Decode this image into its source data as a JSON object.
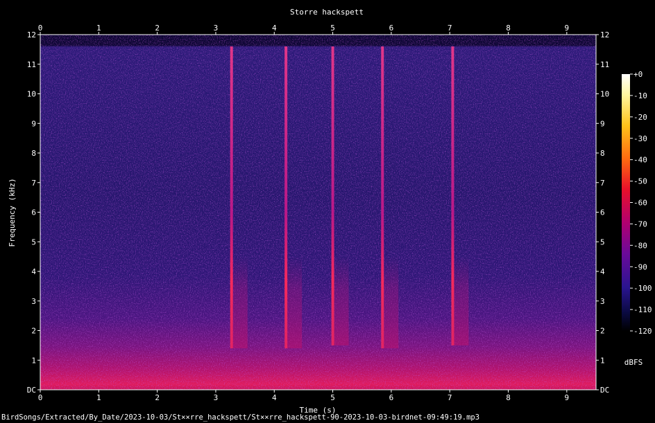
{
  "chart_data": {
    "type": "heatmap",
    "title": "Storre hackspett",
    "xlabel": "Time (s)",
    "ylabel": "Frequency (kHz)",
    "xlim": [
      0,
      9.5
    ],
    "ylim": [
      0,
      12
    ],
    "x_ticks": [
      "0",
      "1",
      "2",
      "3",
      "4",
      "5",
      "6",
      "7",
      "8",
      "9"
    ],
    "y_ticks": [
      "DC",
      "1",
      "2",
      "3",
      "4",
      "5",
      "6",
      "7",
      "8",
      "9",
      "10",
      "11",
      "12"
    ],
    "colorbar": {
      "label": "dBFS",
      "ticks": [
        "+0",
        "-10",
        "-20",
        "-30",
        "-40",
        "-50",
        "-60",
        "-70",
        "-80",
        "-90",
        "-100",
        "-110",
        "-120"
      ],
      "range": [
        -120,
        0
      ]
    },
    "signal_top_khz": 11.6,
    "drum_strikes": [
      {
        "time_s": 3.27,
        "low_khz": 1.4,
        "high_khz": 11.6
      },
      {
        "time_s": 4.2,
        "low_khz": 1.4,
        "high_khz": 11.6
      },
      {
        "time_s": 5.0,
        "low_khz": 1.5,
        "high_khz": 11.6
      },
      {
        "time_s": 5.85,
        "low_khz": 1.4,
        "high_khz": 11.6
      },
      {
        "time_s": 7.05,
        "low_khz": 1.5,
        "high_khz": 11.6
      }
    ]
  },
  "footer": {
    "file_path": "BirdSongs/Extracted/By_Date/2023-10-03/St××rre_hackspett/St××rre_hackspett-90-2023-10-03-birdnet-09:49:19.mp3"
  },
  "colors": {
    "background": "#000000",
    "text": "#ffffff",
    "noise_floor": "#1a0f55",
    "low_band": "#d0105a"
  }
}
